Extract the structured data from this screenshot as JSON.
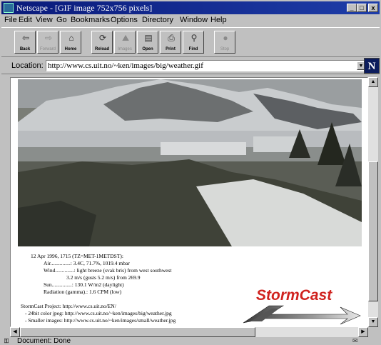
{
  "window": {
    "title": "Netscape - [GIF image 752x756 pixels]",
    "minimize": "_",
    "maximize": "□",
    "close": "x"
  },
  "menu": [
    {
      "label": "File"
    },
    {
      "label": "Edit"
    },
    {
      "label": "View"
    },
    {
      "label": "Go"
    },
    {
      "label": "Bookmarks"
    },
    {
      "label": "Options"
    },
    {
      "label": "Directory"
    },
    {
      "label": "Window"
    },
    {
      "label": "Help"
    }
  ],
  "toolbar": {
    "back": "Back",
    "forward": "Forward",
    "home": "Home",
    "reload": "Reload",
    "images": "Images",
    "open": "Open",
    "print": "Print",
    "find": "Find",
    "stop": "Stop"
  },
  "location": {
    "label": "Location:",
    "url": "http://www.cs.uit.no/~ken/images/big/weather.gif"
  },
  "logo_letter": "N",
  "weather": {
    "date_line": "12 Apr 1996, 1715 (TZ=MET-1METDST):",
    "air": "Air...............: 3.4C, 71.7%, 1019.4 mbar",
    "wind1": "Wind..............: light breeze (svak bris) from west southwest",
    "wind2": "3.2 m/s (gusts 5.2 m/s) from 269.9",
    "sun": "Sun...............: 130.1 W/m2 (daylight)",
    "radiation": "Radiation (gamma).: 1.6 CPM (low)"
  },
  "project": {
    "line1": "StormCast Project: http://www.cs.uit.no/EN/",
    "line2": "- 24bit color jpeg: http://www.cs.uit.no/~ken/images/big/weather.jpg",
    "line3": "- Smaller images: http://www.cs.uit.no/~ken/images/small/weather.jpg"
  },
  "brand": "StormCast",
  "status": {
    "text": "Document: Done"
  }
}
